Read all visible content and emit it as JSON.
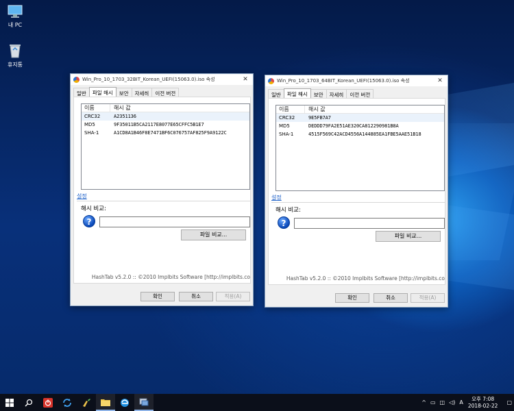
{
  "desktop": {
    "icons": [
      {
        "label": "내 PC",
        "icon": "computer-icon"
      },
      {
        "label": "휴지통",
        "icon": "recycle-bin-icon"
      }
    ]
  },
  "windows": [
    {
      "title": "Win_Pro_10_1703_32BIT_Korean_UEFI(15063.0).iso 속성",
      "tabs": [
        "일반",
        "파일 해시",
        "보안",
        "자세히",
        "이전 버전"
      ],
      "active_tab": "파일 해시",
      "columns": [
        "이름",
        "해시 값"
      ],
      "rows": [
        {
          "name": "CRC32",
          "value": "A2351136"
        },
        {
          "name": "MD5",
          "value": "9F35011B5CA2117E8077E65CFFC5B1E7"
        },
        {
          "name": "SHA-1",
          "value": "A1CD8A1B46F8E7471BF6C076757AF825F9A9122C"
        }
      ],
      "settings_link": "설정",
      "compare_label": "해시 비교:",
      "compare_value": "",
      "file_compare_button": "파일 비교...",
      "footer": "HashTab v5.2.0 :: ©2010 Implbits Software [http://implbits.co",
      "ok": "확인",
      "cancel": "취소",
      "apply": "적용(A)"
    },
    {
      "title": "Win_Pro_10_1703_64BIT_Korean_UEFI(15063.0).iso 속성",
      "tabs": [
        "일반",
        "파일 해시",
        "보안",
        "자세히",
        "이전 버전"
      ],
      "active_tab": "파일 해시",
      "columns": [
        "이름",
        "해시 값"
      ],
      "rows": [
        {
          "name": "CRC32",
          "value": "9E5FB7A7"
        },
        {
          "name": "MD5",
          "value": "DEDDD79FA2E51AE320CA812290981B8A"
        },
        {
          "name": "SHA-1",
          "value": "4515F569C42ACD4556A144885EA1FBE5AAE51B18"
        }
      ],
      "settings_link": "설정",
      "compare_label": "해시 비교:",
      "compare_value": "",
      "file_compare_button": "파일 비교...",
      "footer": "HashTab v5.2.0 :: ©2010 Implbits Software [http://implbits.co",
      "ok": "확인",
      "cancel": "취소",
      "apply": "적용(A)"
    }
  ],
  "taskbar": {
    "items": [
      "windows-start-icon",
      "search-icon",
      "power-app-icon",
      "sync-icon",
      "paint-icon",
      "file-explorer-icon",
      "edge-icon",
      "network-app-icon"
    ],
    "tray": {
      "chevron": "^",
      "ime": "A",
      "time": "오후 7:08",
      "date": "2018-02-22"
    }
  }
}
